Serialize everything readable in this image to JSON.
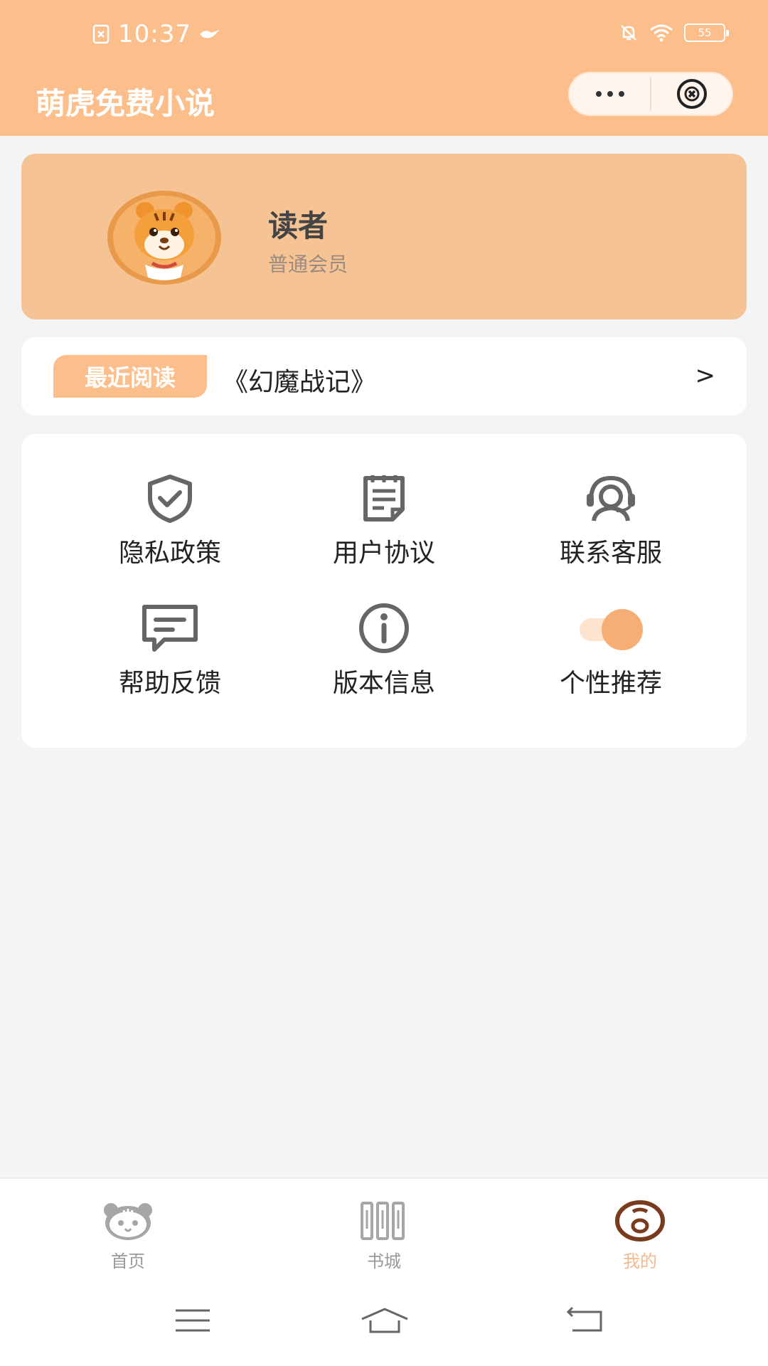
{
  "colors": {
    "brand": "#fcbf8c",
    "card": "#f6c395",
    "background": "#f4f4f6",
    "active_tab": "#f4b98c",
    "icon_gray": "#666666"
  },
  "status_bar": {
    "time": "10:37",
    "battery": "55"
  },
  "header": {
    "title": "萌虎免费小说",
    "more_icon": "more-dots-icon",
    "close_icon": "close-circle-icon"
  },
  "profile": {
    "name": "读者",
    "level": "普通会员",
    "avatar_icon": "tiger-avatar"
  },
  "recent_reading": {
    "tag": "最近阅读",
    "book": "《幻魔战记》",
    "arrow": ">"
  },
  "menu": {
    "items": [
      {
        "label": "隐私政策",
        "icon": "shield-check-icon"
      },
      {
        "label": "用户协议",
        "icon": "document-icon"
      },
      {
        "label": "联系客服",
        "icon": "headset-icon"
      },
      {
        "label": "帮助反馈",
        "icon": "chat-bubble-icon"
      },
      {
        "label": "版本信息",
        "icon": "info-icon"
      },
      {
        "label": "个性推荐",
        "icon": "toggle-icon",
        "toggle_on": true
      }
    ]
  },
  "tabbar": {
    "tabs": [
      {
        "label": "首页",
        "icon": "tiger-face-icon",
        "active": false
      },
      {
        "label": "书城",
        "icon": "bookshelf-icon",
        "active": false
      },
      {
        "label": "我的",
        "icon": "profile-icon",
        "active": true
      }
    ]
  }
}
